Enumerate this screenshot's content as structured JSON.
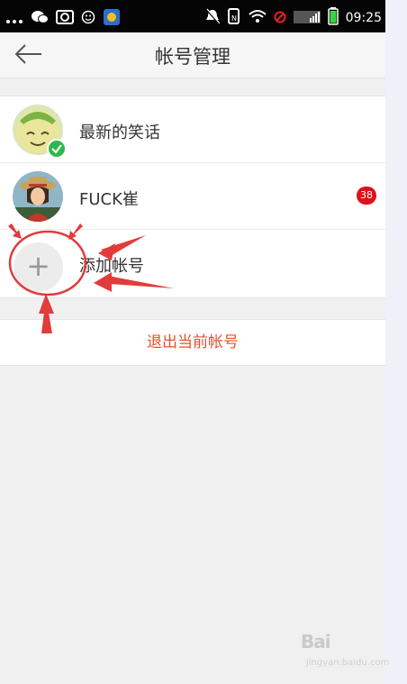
{
  "status_bar": {
    "time": "09:25",
    "left_icons": [
      "more-dots-icon",
      "wechat-icon",
      "camera-icon",
      "smiley-icon",
      "app-icon"
    ],
    "right_icons": [
      "mute-icon",
      "nfc-icon",
      "wifi-icon",
      "no-signal-icon",
      "signal-bars-icon",
      "battery-icon"
    ]
  },
  "header": {
    "title": "帐号管理",
    "back_icon": "back-arrow-icon"
  },
  "accounts": [
    {
      "name": "最新的笑话",
      "active": true
    },
    {
      "name": "FUCK崔",
      "badge": "38"
    }
  ],
  "add_account": {
    "label": "添加帐号",
    "icon": "plus-icon",
    "plus_glyph": "+"
  },
  "logout_label": "退出当前帐号",
  "watermark": {
    "brand": "Bai",
    "sub": "jingyan.baidu.com"
  },
  "colors": {
    "status_bar_bg": "#050505",
    "check_green": "#2eb84b",
    "badge_red": "#e0101a",
    "logout_text": "#e8502a",
    "annotation_red": "#e23b3b"
  }
}
